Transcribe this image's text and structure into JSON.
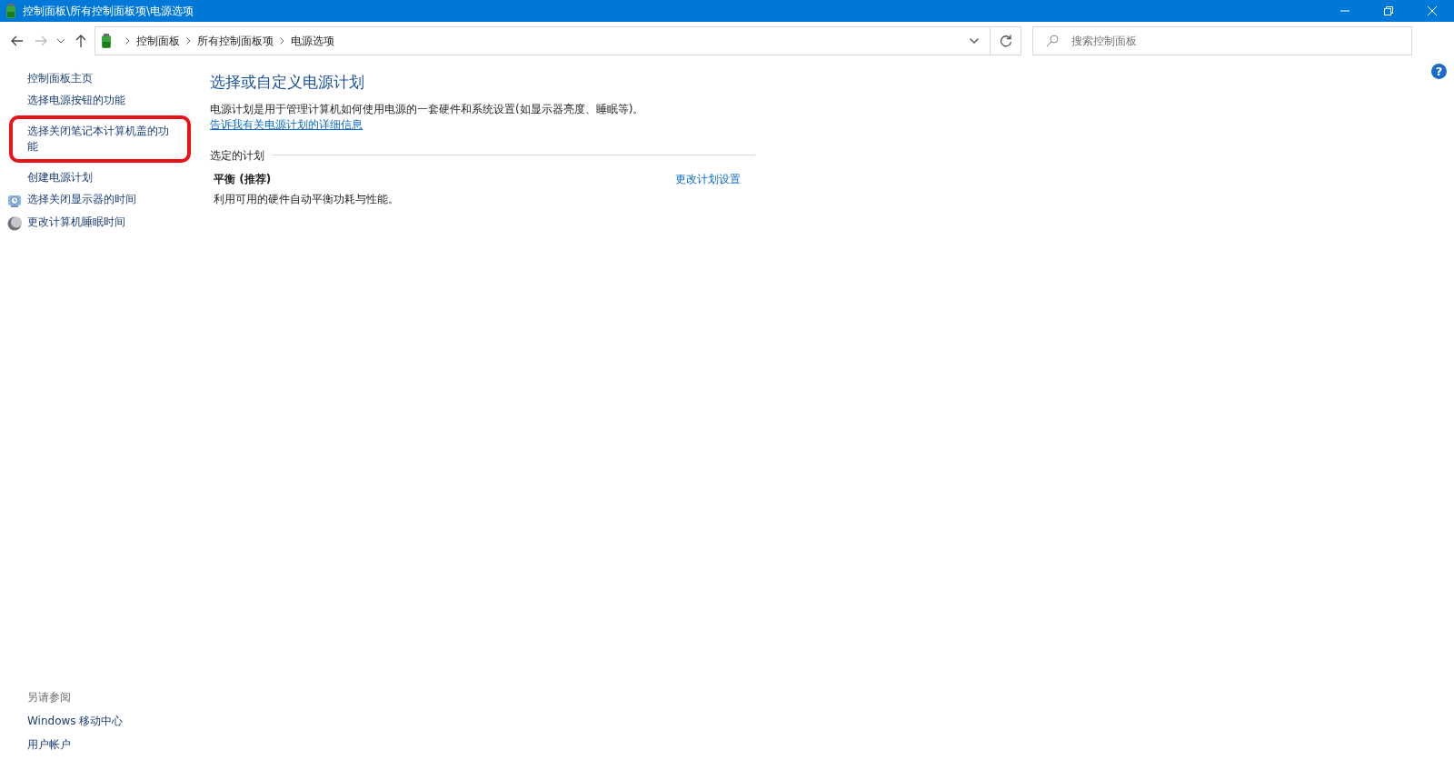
{
  "window": {
    "title": "控制面板\\所有控制面板项\\电源选项"
  },
  "address_bar": {
    "breadcrumbs": [
      "控制面板",
      "所有控制面板项",
      "电源选项"
    ]
  },
  "search": {
    "placeholder": "搜索控制面板"
  },
  "help": {
    "label": "?"
  },
  "sidebar": {
    "items": [
      {
        "label": "控制面板主页",
        "kind": "plain",
        "highlighted": false
      },
      {
        "label": "选择电源按钮的功能",
        "kind": "plain",
        "highlighted": false
      },
      {
        "label": "选择关闭笔记本计算机盖的功能",
        "kind": "plain",
        "highlighted": true
      },
      {
        "label": "创建电源计划",
        "kind": "plain",
        "highlighted": false
      },
      {
        "label": "选择关闭显示器的时间",
        "kind": "display",
        "highlighted": false
      },
      {
        "label": "更改计算机睡眠时间",
        "kind": "sleep",
        "highlighted": false
      }
    ],
    "see_also": {
      "heading": "另请参阅",
      "items": [
        "Windows 移动中心",
        "用户帐户"
      ]
    }
  },
  "main": {
    "title": "选择或自定义电源计划",
    "description": "电源计划是用于管理计算机如何使用电源的一套硬件和系统设置(如显示器亮度、睡眠等)。",
    "link": "告诉我有关电源计划的详细信息",
    "section": "选定的计划",
    "plans": [
      {
        "name": "平衡 (推荐)",
        "description": "利用可用的硬件自动平衡功耗与性能。",
        "action": "更改计划设置",
        "selected": true
      }
    ]
  }
}
